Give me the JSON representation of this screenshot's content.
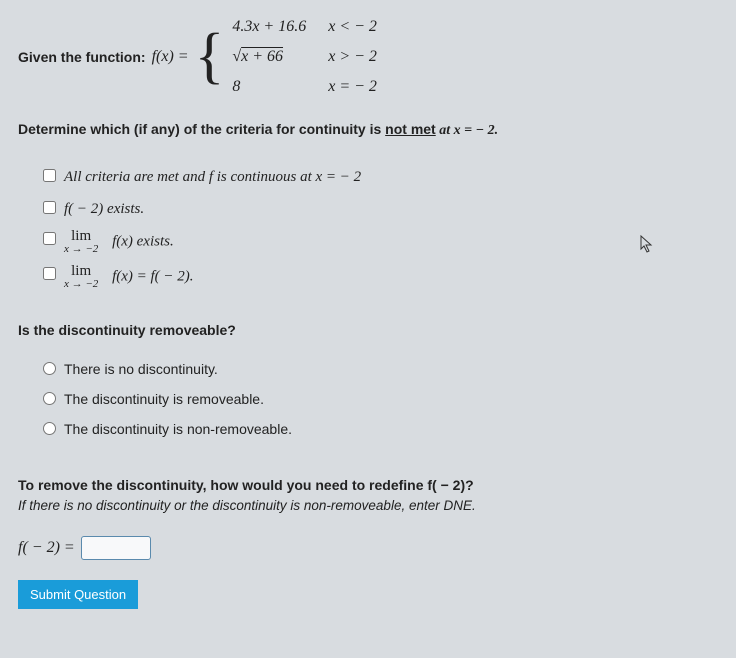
{
  "intro": {
    "label": "Given the function:",
    "fx": "f(x) = ",
    "cases": {
      "r1_expr": "4.3x + 16.6",
      "r1_cond": "x <  − 2",
      "r2_expr_pre": "√",
      "r2_expr_in": "x + 66",
      "r2_cond": "x >  − 2",
      "r3_expr": "8",
      "r3_cond": "x =  − 2"
    }
  },
  "q1": {
    "pre": "Determine which (if any) of the criteria for continuity is ",
    "underlined": "not met",
    "post": " at x =  − 2."
  },
  "criteria": {
    "opt1": "All criteria are met and f is continuous at x =  − 2",
    "opt2": "f( − 2) exists.",
    "opt3_lim": "lim",
    "opt3_sub": "x → −2",
    "opt3_rest": "f(x) exists.",
    "opt4_lim": "lim",
    "opt4_sub": "x → −2",
    "opt4_rest": "f(x) = f( − 2)."
  },
  "q2": {
    "label": "Is the discontinuity removeable?",
    "opt1": "There is no discontinuity.",
    "opt2": "The discontinuity is removeable.",
    "opt3": "The discontinuity is non-removeable."
  },
  "q3": {
    "main": "To remove the discontinuity, how would you need to redefine f( − 2)?",
    "hint": "If there is no discontinuity or the discontinuity is non-removeable, enter DNE.",
    "answer_label": "f( − 2) = "
  },
  "submit": "Submit Question"
}
